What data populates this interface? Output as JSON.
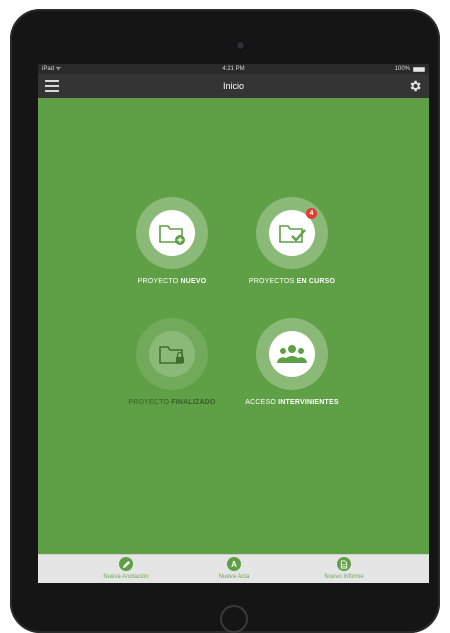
{
  "statusbar": {
    "carrier": "iPad ᯤ",
    "time": "4:21 PM",
    "battery": "100%"
  },
  "navbar": {
    "title": "Inicio"
  },
  "tiles": [
    {
      "label_normal": "PROYECTO ",
      "label_bold": "NUEVO",
      "icon": "folder-plus-icon",
      "enabled": true
    },
    {
      "label_normal": "PROYECTOS ",
      "label_bold": "EN CURSO",
      "icon": "folder-check-icon",
      "badge": "4",
      "enabled": true
    },
    {
      "label_normal": "PROYECTO ",
      "label_bold": "FINALIZADO",
      "icon": "folder-lock-icon",
      "enabled": false
    },
    {
      "label_normal": "ACCESO ",
      "label_bold": "INTERVINIENTES",
      "icon": "group-icon",
      "enabled": true
    }
  ],
  "tabbar": {
    "items": [
      {
        "label": "Nueva Anotación",
        "icon": "pencil-icon"
      },
      {
        "label": "Nueva Acta",
        "icon": "a-letter-icon",
        "glyph": "A"
      },
      {
        "label": "Nuevo Informe",
        "icon": "document-icon"
      }
    ]
  },
  "colors": {
    "accent": "#5f9f45",
    "navbar": "#343434",
    "badge": "#e53935"
  }
}
